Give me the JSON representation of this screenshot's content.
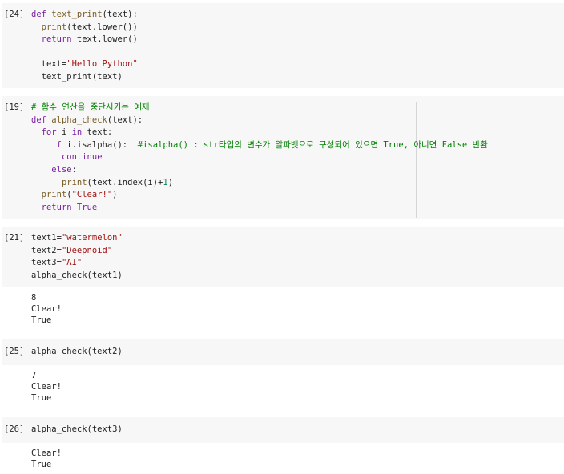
{
  "cells": [
    {
      "prompt": "[24]",
      "code": [
        [
          {
            "t": "def ",
            "c": "kw"
          },
          {
            "t": "text_print",
            "c": "fn"
          },
          {
            "t": "(text):",
            "c": "tx"
          }
        ],
        [
          {
            "t": "  ",
            "c": "tx"
          },
          {
            "t": "print",
            "c": "bi"
          },
          {
            "t": "(text.lower())",
            "c": "tx"
          }
        ],
        [
          {
            "t": "  ",
            "c": "tx"
          },
          {
            "t": "return",
            "c": "kw"
          },
          {
            "t": " text.lower()",
            "c": "tx"
          }
        ],
        [],
        [
          {
            "t": "  text=",
            "c": "tx"
          },
          {
            "t": "\"Hello Python\"",
            "c": "str"
          }
        ],
        [
          {
            "t": "  text_print(text)",
            "c": "tx"
          }
        ]
      ],
      "output": []
    },
    {
      "prompt": "[19]",
      "code": [
        [
          {
            "t": "# 함수 연산을 중단시키는 예제",
            "c": "cm"
          }
        ],
        [
          {
            "t": "def ",
            "c": "kw"
          },
          {
            "t": "alpha_check",
            "c": "fn"
          },
          {
            "t": "(text):",
            "c": "tx"
          }
        ],
        [
          {
            "t": "  ",
            "c": "tx"
          },
          {
            "t": "for",
            "c": "kw"
          },
          {
            "t": " i ",
            "c": "tx"
          },
          {
            "t": "in",
            "c": "kw"
          },
          {
            "t": " text:",
            "c": "tx"
          }
        ],
        [
          {
            "t": "    ",
            "c": "tx"
          },
          {
            "t": "if",
            "c": "kw"
          },
          {
            "t": " i.isalpha():  ",
            "c": "tx"
          },
          {
            "t": "#isalpha() : str타입의 변수가 알파벳으로 구성되어 있으면 True, 아니면 False 반환",
            "c": "cm"
          }
        ],
        [
          {
            "t": "      ",
            "c": "tx"
          },
          {
            "t": "continue",
            "c": "kw"
          }
        ],
        [
          {
            "t": "    ",
            "c": "tx"
          },
          {
            "t": "else",
            "c": "kw"
          },
          {
            "t": ":",
            "c": "tx"
          }
        ],
        [
          {
            "t": "      ",
            "c": "tx"
          },
          {
            "t": "print",
            "c": "bi"
          },
          {
            "t": "(text.index(i)+",
            "c": "tx"
          },
          {
            "t": "1",
            "c": "num"
          },
          {
            "t": ")",
            "c": "tx"
          }
        ],
        [
          {
            "t": "  ",
            "c": "tx"
          },
          {
            "t": "print",
            "c": "bi"
          },
          {
            "t": "(",
            "c": "tx"
          },
          {
            "t": "\"Clear!\"",
            "c": "str"
          },
          {
            "t": ")",
            "c": "tx"
          }
        ],
        [
          {
            "t": "  ",
            "c": "tx"
          },
          {
            "t": "return",
            "c": "kw"
          },
          {
            "t": " True",
            "c": "kw"
          }
        ]
      ],
      "output": []
    },
    {
      "prompt": "[21]",
      "code": [
        [
          {
            "t": "text1=",
            "c": "tx"
          },
          {
            "t": "\"watermelon\"",
            "c": "str"
          }
        ],
        [
          {
            "t": "text2=",
            "c": "tx"
          },
          {
            "t": "\"Deepnoid\"",
            "c": "str"
          }
        ],
        [
          {
            "t": "text3=",
            "c": "tx"
          },
          {
            "t": "\"AI\"",
            "c": "str"
          }
        ],
        [
          {
            "t": "alpha_check(text1)",
            "c": "tx"
          }
        ]
      ],
      "output": [
        "8",
        "Clear!",
        "True"
      ]
    },
    {
      "prompt": "[25]",
      "code": [
        [
          {
            "t": "alpha_check(text2)",
            "c": "tx"
          }
        ]
      ],
      "output": [
        "7",
        "Clear!",
        "True"
      ]
    },
    {
      "prompt": "[26]",
      "code": [
        [
          {
            "t": "alpha_check(text3)",
            "c": "tx"
          }
        ]
      ],
      "output": [
        "Clear!",
        "True"
      ]
    }
  ]
}
